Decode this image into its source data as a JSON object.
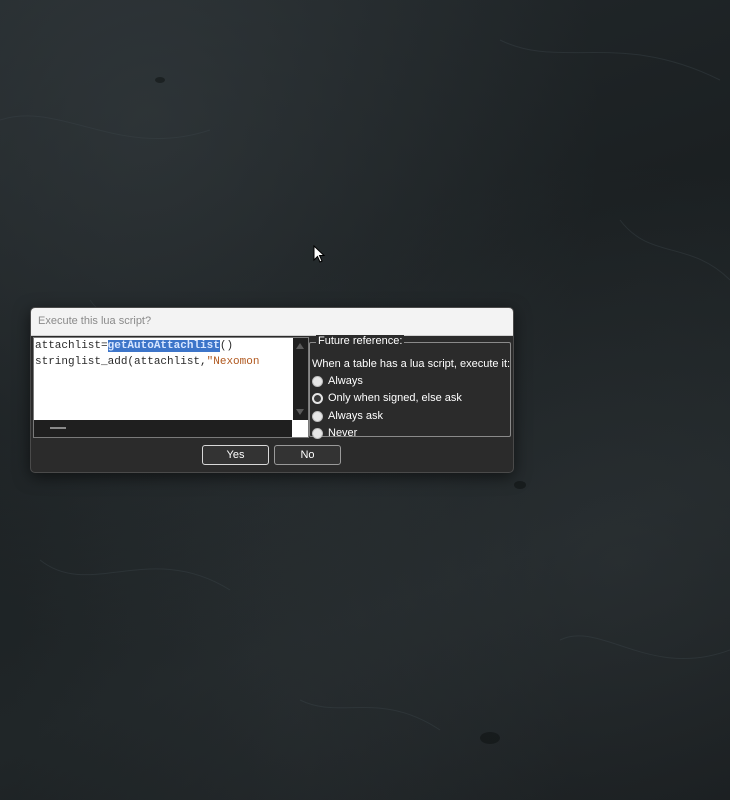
{
  "dialog": {
    "title": "Execute this lua script?",
    "script": {
      "line1_prefix": "attachlist=",
      "line1_selected": "getAutoAttachlist",
      "line1_suffix": "()",
      "line2_prefix": "stringlist_add(attachlist,",
      "line2_string": "\"Nexomon"
    },
    "future_reference": {
      "legend": "Future reference:",
      "description": "When a table has a lua script, execute it:",
      "options": [
        {
          "label": "Always",
          "checked": false
        },
        {
          "label": "Only when signed, else ask",
          "checked": true
        },
        {
          "label": "Always ask",
          "checked": false
        },
        {
          "label": "Never",
          "checked": false
        }
      ]
    },
    "buttons": {
      "yes_label": "Yes",
      "no_label": "No"
    }
  },
  "colors": {
    "selection": "#3d75c9",
    "string_literal": "#b0581e",
    "dialog_bg": "#2b2b2b",
    "titlebar_bg": "#f3f3f3"
  },
  "icons": {
    "cursor": "mouse-pointer-icon"
  }
}
